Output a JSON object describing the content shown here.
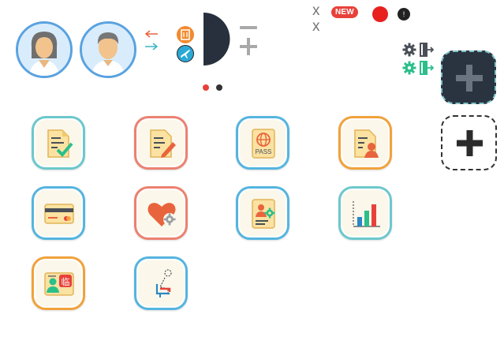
{
  "header": {
    "badge_new": "NEW",
    "close_glyph": "x"
  },
  "icons": {
    "avatar_female": "avatar-female-icon",
    "avatar_male": "avatar-male-icon",
    "arrow_left": "arrow-left-icon",
    "arrow_right": "arrow-right-icon",
    "building": "building-icon",
    "plane": "plane-icon",
    "minus": "minus-icon",
    "plus": "plus-icon",
    "gear_dark": "gear-icon",
    "gear_green": "gear-icon",
    "exit_dark": "exit-icon",
    "exit_green": "exit-icon"
  },
  "pagination": {
    "total": 2,
    "active": 1
  },
  "tiles": [
    {
      "name": "checklist-document",
      "border": "#6cc8cc"
    },
    {
      "name": "edit-document",
      "border": "#ec8170"
    },
    {
      "name": "passport",
      "border": "#55b5df",
      "label": "PASS"
    },
    {
      "name": "person-document",
      "border": "#f1a23b"
    },
    {
      "name": "credit-card",
      "border": "#55b5df"
    },
    {
      "name": "health-settings",
      "border": "#ec8170"
    },
    {
      "name": "profile-settings",
      "border": "#55b5df"
    },
    {
      "name": "bar-chart",
      "border": "#6cc8cc"
    },
    {
      "name": "interpreter",
      "border": "#f1a23b",
      "label": "临"
    },
    {
      "name": "seat",
      "border": "#55b5df"
    }
  ],
  "colors": {
    "red_dot": "#e8413a",
    "dark_dot": "#333333",
    "accent_green": "#2bbf8a"
  }
}
